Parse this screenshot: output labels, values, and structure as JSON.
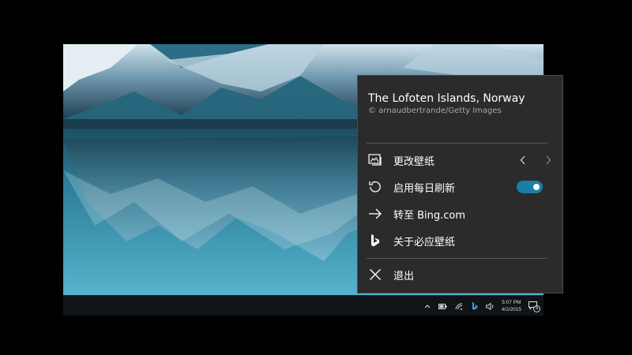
{
  "wallpaper": {
    "title": "The Lofoten Islands, Norway",
    "copyright": "© arnaudbertrande/Getty Images"
  },
  "menu": {
    "items": [
      {
        "label": "更改壁纸",
        "icon": "image-icon"
      },
      {
        "label": "启用每日刷新",
        "icon": "refresh-icon",
        "toggle_on": true
      },
      {
        "label": "转至 Bing.com",
        "icon": "arrow-right-icon"
      },
      {
        "label": "关于必应壁纸",
        "icon": "bing-logo-icon"
      },
      {
        "label": "退出",
        "icon": "close-icon"
      }
    ]
  },
  "taskbar": {
    "time": "5:07 PM",
    "date": "4/2/2015",
    "notification_count": "5"
  },
  "colors": {
    "menu_bg": "#2b2b2b",
    "toggle_on": "#1a7fa5",
    "taskbar_bg": "#101417"
  }
}
